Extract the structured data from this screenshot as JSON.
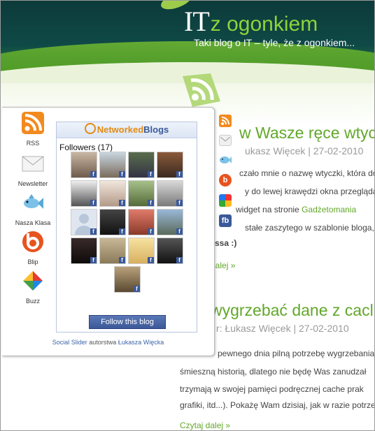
{
  "header": {
    "logo_it": "IT",
    "logo_rest": "z ogonkiem",
    "tagline": "Taki blog o IT – tyle, że z ogonkiem..."
  },
  "posts": [
    {
      "title": "w Wasze ręce wtyc",
      "meta": "ukasz Więcek | 27-02-2010",
      "lines": [
        "czało mnie o nazwę wtyczki, która do",
        "y do lewej krawędzi okna przegląda",
        "widget na stronie",
        "stałe zaszytego w szablonie bloga, a",
        "ssa :)"
      ],
      "link_text": "Gadżetomania",
      "read_more": "dalej »"
    },
    {
      "title": "wygrzebać dane z cacl",
      "meta": "r: Łukasz Więcek | 27-02-2010",
      "lines": [
        "pewnego dnia pilną potrzebę wygrzebania c",
        "śmieszną historią, dlatego nie będę Was zanudzał",
        "trzymają w swojej pamięci podręcznej cache prak",
        "grafiki, itd...). Pokażę Wam dzisiaj, jak w razie potrzeb"
      ],
      "read_more": "Czytaj dalej »"
    }
  ],
  "slider": {
    "services": [
      {
        "label": "RSS",
        "icon": "rss-icon"
      },
      {
        "label": "Newsletter",
        "icon": "envelope-icon"
      },
      {
        "label": "Nasza Klasa",
        "icon": "fish-icon"
      },
      {
        "label": "Blip",
        "icon": "blip-icon"
      },
      {
        "label": "Buzz",
        "icon": "buzz-icon"
      }
    ],
    "networked_blogs": {
      "brand_part1": "Networked",
      "brand_part2": "Blogs",
      "followers_label": "Followers (17)",
      "follow_button": "Follow this blog"
    },
    "credit_link1": "Social Slider",
    "credit_mid": " autorstwa ",
    "credit_link2": "Łukasza Więcka"
  },
  "colors": {
    "accent_green": "#62a82a",
    "facebook_blue": "#3b5998",
    "header_dark": "#0f4a47"
  }
}
